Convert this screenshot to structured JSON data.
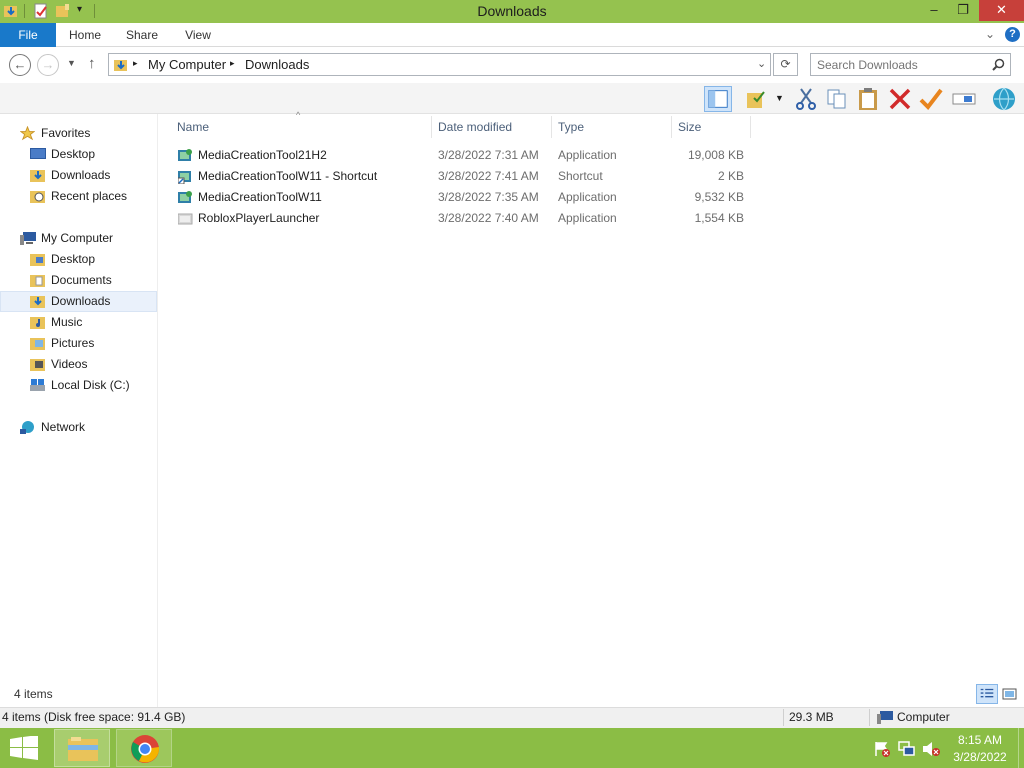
{
  "window": {
    "title": "Downloads",
    "minimize": "–",
    "maximize": "❐",
    "close": "✕"
  },
  "ribbon": {
    "file": "File",
    "home": "Home",
    "share": "Share",
    "view": "View",
    "help": "?"
  },
  "address": {
    "crumbs": [
      "My Computer",
      "Downloads"
    ],
    "search_placeholder": "Search Downloads"
  },
  "nav": {
    "favorites": {
      "label": "Favorites",
      "items": [
        "Desktop",
        "Downloads",
        "Recent places"
      ]
    },
    "computer": {
      "label": "My Computer",
      "items": [
        "Desktop",
        "Documents",
        "Downloads",
        "Music",
        "Pictures",
        "Videos",
        "Local Disk (C:)"
      ]
    },
    "network": {
      "label": "Network"
    }
  },
  "columns": {
    "name": "Name",
    "date": "Date modified",
    "type": "Type",
    "size": "Size"
  },
  "files": [
    {
      "name": "MediaCreationTool21H2",
      "date": "3/28/2022 7:31 AM",
      "type": "Application",
      "size": "19,008 KB",
      "icon": "media-tool-icon"
    },
    {
      "name": "MediaCreationToolW11 - Shortcut",
      "date": "3/28/2022 7:41 AM",
      "type": "Shortcut",
      "size": "2 KB",
      "icon": "shortcut-icon"
    },
    {
      "name": "MediaCreationToolW11",
      "date": "3/28/2022 7:35 AM",
      "type": "Application",
      "size": "9,532 KB",
      "icon": "media-tool-icon"
    },
    {
      "name": "RobloxPlayerLauncher",
      "date": "3/28/2022 7:40 AM",
      "type": "Application",
      "size": "1,554 KB",
      "icon": "roblox-icon"
    }
  ],
  "status": {
    "count": "4 items",
    "disk": "4 items (Disk free space: 91.4 GB)",
    "size": "29.3 MB",
    "location": "Computer"
  },
  "clock": {
    "time": "8:15 AM",
    "date": "3/28/2022"
  },
  "colors": {
    "title_bar": "#95c24f",
    "taskbar": "#8bbd45",
    "file_tab": "#1979ca",
    "close": "#c7403a"
  }
}
